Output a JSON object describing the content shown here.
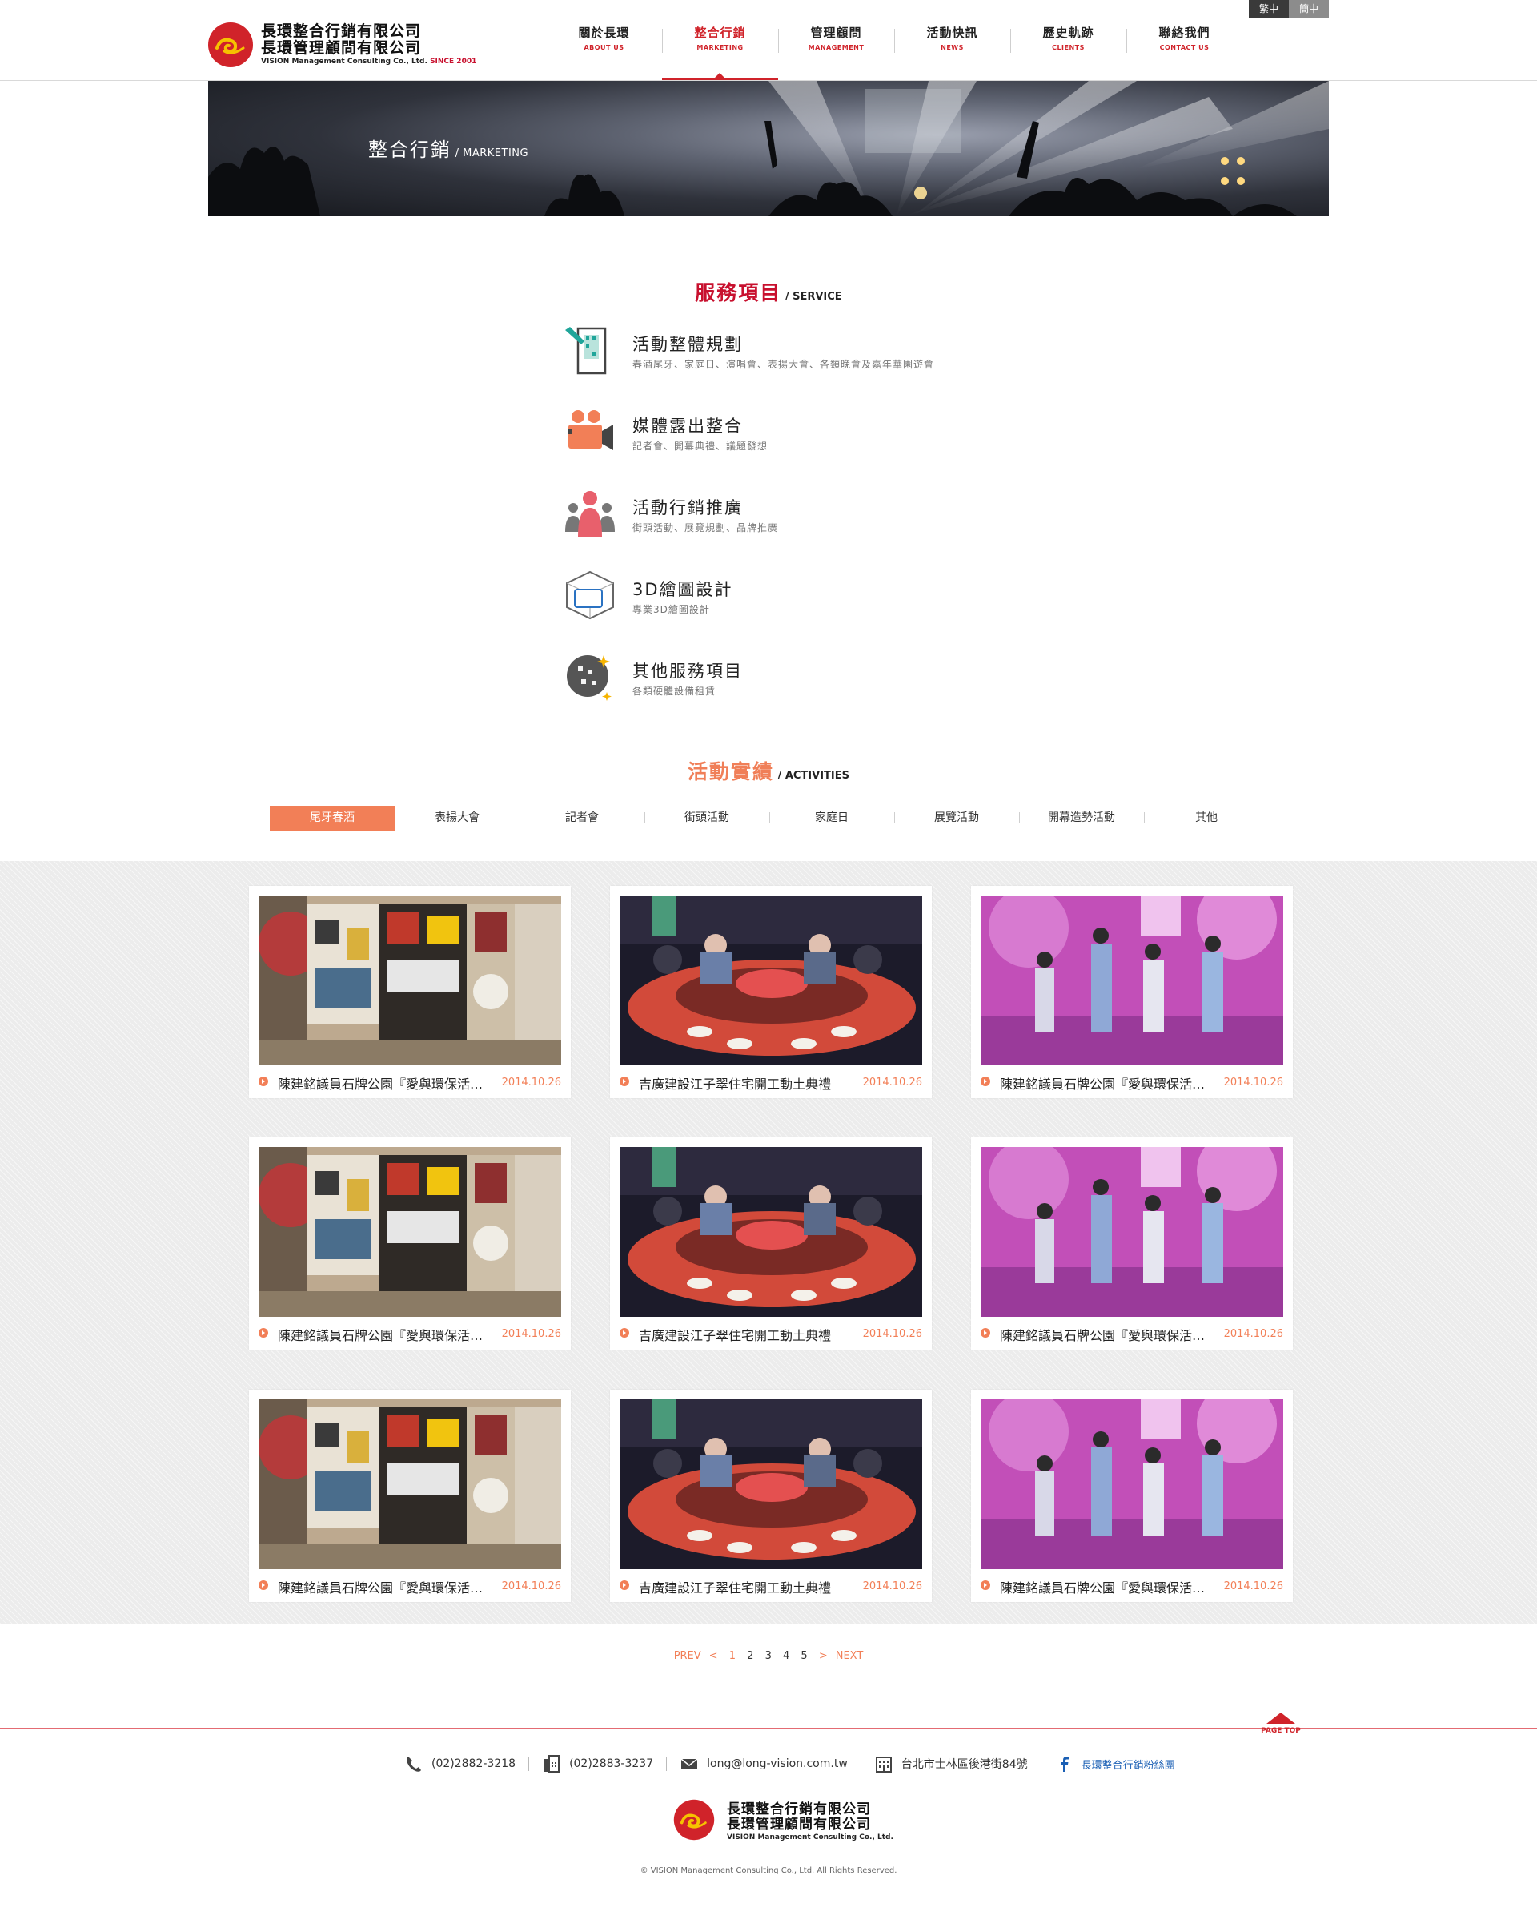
{
  "header": {
    "company_line1": "長環整合行銷有限公司",
    "company_line2": "長環管理顧問有限公司",
    "company_en": "VISION Management Consulting Co., Ltd.",
    "since": "SINCE 2001",
    "nav": [
      {
        "zh": "關於長環",
        "en": "ABOUT US"
      },
      {
        "zh": "整合行銷",
        "en": "MARKETING"
      },
      {
        "zh": "管理顧問",
        "en": "MANAGEMENT"
      },
      {
        "zh": "活動快訊",
        "en": "NEWS"
      },
      {
        "zh": "歷史軌跡",
        "en": "CLIENTS"
      },
      {
        "zh": "聯絡我們",
        "en": "CONTACT US"
      }
    ],
    "lang": {
      "traditional": "繁中",
      "simplified": "簡中"
    }
  },
  "banner": {
    "title_zh": "整合行銷",
    "title_en": " / MARKETING"
  },
  "services_section": {
    "title_zh": "服務項目",
    "title_en": " / SERVICE",
    "items": [
      {
        "name": "活動整體規劃",
        "desc": "春酒尾牙、家庭日、演唱會、表揚大會、各類晚會及嘉年華園遊會",
        "icon": "building-icon"
      },
      {
        "name": "媒體露出整合",
        "desc": "記者會、開幕典禮、議題發想",
        "icon": "video-camera-icon"
      },
      {
        "name": "活動行銷推廣",
        "desc": "街頭活動、展覽規劃、品牌推廣",
        "icon": "people-group-icon"
      },
      {
        "name": "3D繪圖設計",
        "desc": "專業3D繪圖設計",
        "icon": "3d-cube-icon"
      },
      {
        "name": "其他服務項目",
        "desc": "各類硬體設備租賃",
        "icon": "disco-ball-icon"
      }
    ]
  },
  "activities_section": {
    "title_zh": "活動實績",
    "title_en": " / ACTIVITIES",
    "tabs": [
      "尾牙春酒",
      "表揚大會",
      "記者會",
      "街頭活動",
      "家庭日",
      "展覽活動",
      "開幕造勢活動",
      "其他"
    ],
    "active_tab": 0
  },
  "gallery": {
    "cards": [
      {
        "title": "陳建銘議員石牌公園『愛與環保活動』",
        "date": "2014.10.26",
        "image": "poster-wall"
      },
      {
        "title": "吉廣建設江子翠住宅開工動土典禮",
        "date": "2014.10.26",
        "image": "banquet"
      },
      {
        "title": "陳建銘議員石牌公園『愛與環保活動』",
        "date": "2014.10.26",
        "image": "stage-performers"
      },
      {
        "title": "陳建銘議員石牌公園『愛與環保活動』",
        "date": "2014.10.26",
        "image": "poster-wall"
      },
      {
        "title": "吉廣建設江子翠住宅開工動土典禮",
        "date": "2014.10.26",
        "image": "banquet"
      },
      {
        "title": "陳建銘議員石牌公園『愛與環保活動』",
        "date": "2014.10.26",
        "image": "stage-performers"
      },
      {
        "title": "陳建銘議員石牌公園『愛與環保活動』",
        "date": "2014.10.26",
        "image": "poster-wall"
      },
      {
        "title": "吉廣建設江子翠住宅開工動土典禮",
        "date": "2014.10.26",
        "image": "banquet"
      },
      {
        "title": "陳建銘議員石牌公園『愛與環保活動』",
        "date": "2014.10.26",
        "image": "stage-performers"
      }
    ]
  },
  "pagination": {
    "prev": "PREV",
    "prev_arrow": "<",
    "pages": [
      "1",
      "2",
      "3",
      "4",
      "5"
    ],
    "current": "1",
    "next_arrow": ">",
    "next": "NEXT"
  },
  "footer": {
    "page_top": "PAGE TOP",
    "phone": "(02)2882-3218",
    "fax": "(02)2883-3237",
    "email": "long@long-vision.com.tw",
    "address": "台北市士林區後港街84號",
    "facebook": "長環整合行銷粉絲團",
    "company_line1": "長環整合行銷有限公司",
    "company_line2": "長環管理顧問有限公司",
    "company_en": "VISION Management Consulting Co., Ltd.",
    "copyright": "© VISION Management Consulting Co., Ltd. All Rights Reserved."
  },
  "colors": {
    "brand_red": "#d0232a",
    "accent_orange": "#f27f57"
  }
}
